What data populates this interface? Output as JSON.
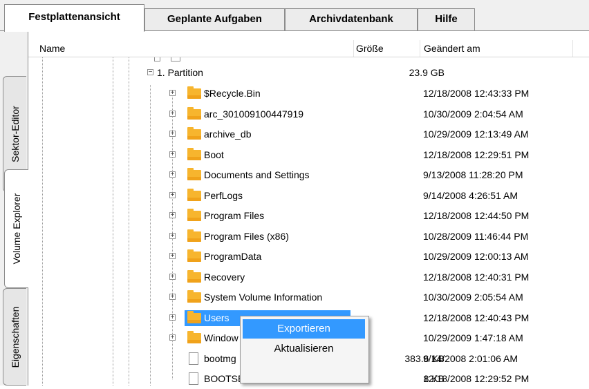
{
  "tabs": [
    {
      "label": "Festplattenansicht",
      "active": true
    },
    {
      "label": "Geplante Aufgaben",
      "active": false
    },
    {
      "label": "Archivdatenbank",
      "active": false
    },
    {
      "label": "Hilfe",
      "active": false
    }
  ],
  "side_tabs": [
    {
      "label": "Sektor-Editor",
      "active": false
    },
    {
      "label": "Volume Explorer",
      "active": true
    },
    {
      "label": "Eigenschaften",
      "active": false
    }
  ],
  "columns": {
    "name": "Name",
    "size": "Größe",
    "modified": "Geändert am"
  },
  "partition": {
    "label": "1. Partition",
    "size": "23.9 GB"
  },
  "rows": [
    {
      "name": "$Recycle.Bin",
      "size": "",
      "date": "12/18/2008 12:43:33 PM",
      "type": "folder"
    },
    {
      "name": "arc_301009100447919",
      "size": "",
      "date": "10/30/2009 2:04:54 AM",
      "type": "folder"
    },
    {
      "name": "archive_db",
      "size": "",
      "date": "10/29/2009 12:13:49 AM",
      "type": "folder"
    },
    {
      "name": "Boot",
      "size": "",
      "date": "12/18/2008 12:29:51 PM",
      "type": "folder"
    },
    {
      "name": "Documents and Settings",
      "size": "",
      "date": "9/13/2008 11:28:20 PM",
      "type": "folder"
    },
    {
      "name": "PerfLogs",
      "size": "",
      "date": "9/14/2008 4:26:51 AM",
      "type": "folder"
    },
    {
      "name": "Program Files",
      "size": "",
      "date": "12/18/2008 12:44:50 PM",
      "type": "folder"
    },
    {
      "name": "Program Files (x86)",
      "size": "",
      "date": "10/28/2009 11:46:44 PM",
      "type": "folder"
    },
    {
      "name": "ProgramData",
      "size": "",
      "date": "10/29/2009 12:00:13 AM",
      "type": "folder"
    },
    {
      "name": "Recovery",
      "size": "",
      "date": "12/18/2008 12:40:31 PM",
      "type": "folder"
    },
    {
      "name": "System Volume Information",
      "size": "",
      "date": "10/30/2009 2:05:54 AM",
      "type": "folder"
    },
    {
      "name": "Users",
      "size": "",
      "date": "12/18/2008 12:40:43 PM",
      "type": "folder",
      "selected": true
    },
    {
      "name": "Window",
      "size": "",
      "date": "10/29/2009 1:47:18 AM",
      "type": "folder"
    },
    {
      "name": "bootmg",
      "size": "383.6 KB",
      "date": "9/14/2008 2:01:06 AM",
      "type": "file"
    },
    {
      "name": "BOOTSECT.BAK",
      "size": "8 KB",
      "date": "12/18/2008 12:29:52 PM",
      "type": "file"
    }
  ],
  "context_menu": {
    "items": [
      {
        "label": "Exportieren",
        "highlighted": true
      },
      {
        "label": "Aktualisieren",
        "highlighted": false
      }
    ]
  },
  "colors": {
    "accent": "#3399ff",
    "folder": "#f7b52e"
  },
  "icons": {
    "folder": "folder-icon",
    "file": "file-icon",
    "expand": "expand-plus-icon",
    "collapse": "collapse-minus-icon"
  }
}
